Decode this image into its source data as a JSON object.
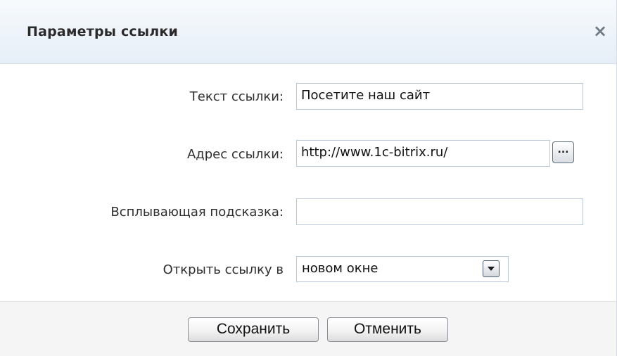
{
  "dialog": {
    "title": "Параметры ссылки",
    "close_icon": "close-icon",
    "close_glyph": "×"
  },
  "form": {
    "link_text": {
      "label": "Текст ссылки:",
      "value": "Посетите наш сайт"
    },
    "link_address": {
      "label": "Адрес ссылки:",
      "value": "http://www.1c-bitrix.ru/",
      "browse_label": "..."
    },
    "tooltip": {
      "label": "Всплывающая подсказка:",
      "value": ""
    },
    "open_in": {
      "label": "Открыть ссылку в",
      "selected": "новом окне",
      "arrow_icon": "chevron-down-icon"
    }
  },
  "footer": {
    "save_label": "Сохранить",
    "cancel_label": "Отменить"
  }
}
